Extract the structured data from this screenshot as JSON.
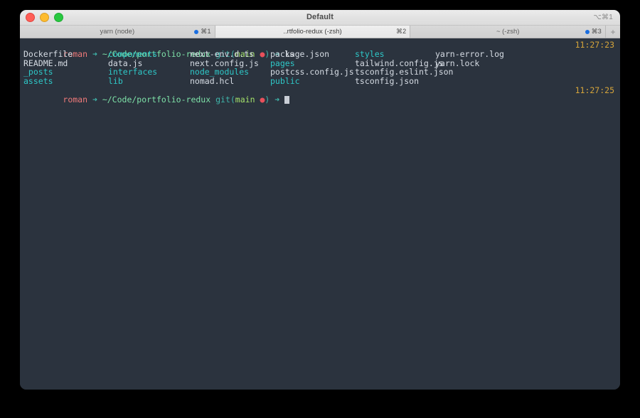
{
  "window": {
    "title": "Default",
    "shortcut": "⌥⌘1",
    "controls": {
      "close": "close-button",
      "minimize": "minimize-button",
      "maximize": "maximize-button"
    },
    "add_tab_label": "+"
  },
  "tabs": [
    {
      "label": "yarn (node)",
      "key": "⌘1",
      "has_dot": true,
      "active": false
    },
    {
      "label": "..rtfolio-redux (-zsh)",
      "key": "⌘2",
      "has_dot": false,
      "active": true
    },
    {
      "label": "~ (-zsh)",
      "key": "⌘3",
      "has_dot": true,
      "active": false
    }
  ],
  "terminal": {
    "prompt": {
      "user": "roman",
      "arrow": "➜",
      "path": "~/Code/portfolio-redux",
      "git_open": "git(",
      "branch": "main",
      "dirty": "●",
      "git_close": ")",
      "arrow2": "➜"
    },
    "command": "ls",
    "timestamps": {
      "command_line": "11:27:23",
      "prompt_line": "11:27:25"
    },
    "ls_rows": [
      [
        {
          "name": "Dockerfile",
          "kind": "file"
        },
        {
          "name": "components",
          "kind": "dir"
        },
        {
          "name": "next-env.d.ts",
          "kind": "file"
        },
        {
          "name": "package.json",
          "kind": "file"
        },
        {
          "name": "styles",
          "kind": "dir"
        },
        {
          "name": "yarn-error.log",
          "kind": "file"
        }
      ],
      [
        {
          "name": "README.md",
          "kind": "file"
        },
        {
          "name": "data.js",
          "kind": "file"
        },
        {
          "name": "next.config.js",
          "kind": "file"
        },
        {
          "name": "pages",
          "kind": "dir"
        },
        {
          "name": "tailwind.config.js",
          "kind": "file"
        },
        {
          "name": "yarn.lock",
          "kind": "file"
        }
      ],
      [
        {
          "name": "_posts",
          "kind": "dir"
        },
        {
          "name": "interfaces",
          "kind": "dir"
        },
        {
          "name": "node_modules",
          "kind": "dir"
        },
        {
          "name": "postcss.config.js",
          "kind": "file"
        },
        {
          "name": "tsconfig.eslint.json",
          "kind": "file"
        },
        {
          "name": "",
          "kind": "file"
        }
      ],
      [
        {
          "name": "assets",
          "kind": "dir"
        },
        {
          "name": "lib",
          "kind": "dir"
        },
        {
          "name": "nomad.hcl",
          "kind": "file"
        },
        {
          "name": "public",
          "kind": "dir"
        },
        {
          "name": "tsconfig.json",
          "kind": "file"
        },
        {
          "name": "",
          "kind": "file"
        }
      ]
    ]
  },
  "colors": {
    "terminal_bg": "#2b333e",
    "directory": "#2ec8c8",
    "file": "#d6dce4",
    "user": "#f07a7a",
    "path": "#7ee2a8",
    "git": "#3fb5aa",
    "branch": "#a3e06a",
    "dirty": "#e8505b",
    "timestamp": "#d5a43a",
    "tab_dot": "#1a6ee0"
  }
}
